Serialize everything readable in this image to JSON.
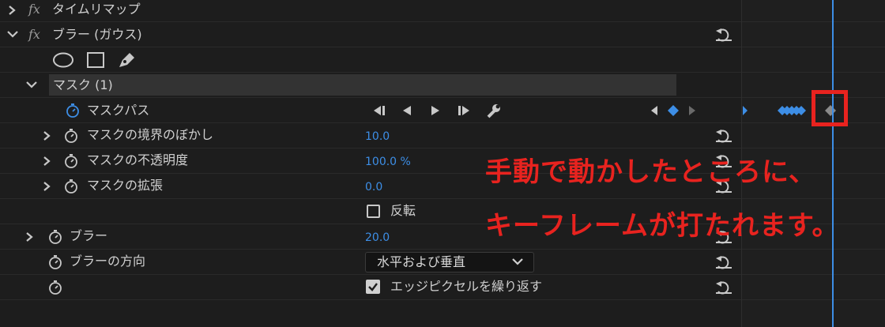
{
  "rows": {
    "time_remap": {
      "fx": "fx",
      "label": "タイムリマップ"
    },
    "blur_effect": {
      "fx": "fx",
      "label": "ブラー (ガウス)"
    },
    "mask": {
      "label": "マスク (1)"
    },
    "mask_path": {
      "label": "マスクパス"
    },
    "mask_feather": {
      "label": "マスクの境界のぼかし",
      "value": "10.0"
    },
    "mask_opacity": {
      "label": "マスクの不透明度",
      "value": "100.0 %"
    },
    "mask_expansion": {
      "label": "マスクの拡張",
      "value": "0.0"
    },
    "inverted": {
      "label": "反転",
      "checked": false
    },
    "blurriness": {
      "label": "ブラー",
      "value": "20.0"
    },
    "blur_direction": {
      "label": "ブラーの方向",
      "selected": "水平および垂直"
    },
    "repeat_edge": {
      "label": "エッジピクセルを繰り返す",
      "checked": true
    }
  },
  "annotation": {
    "line1": "手動で動かしたところに、",
    "line2": "キーフレームが打たれます。"
  },
  "colors": {
    "accent": "#3d8ee6",
    "annotation": "#e8231f",
    "background": "#1d1d1d"
  }
}
